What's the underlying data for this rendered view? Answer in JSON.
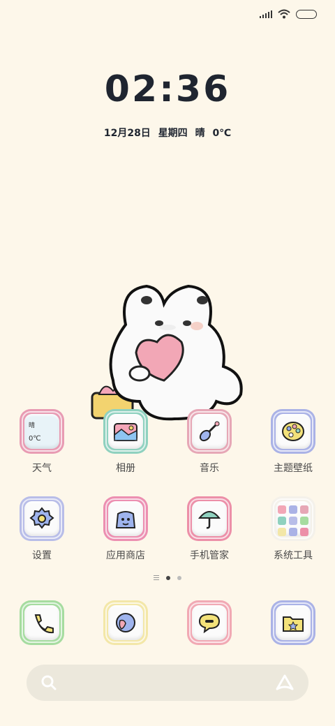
{
  "clock": {
    "time": "02:36"
  },
  "date_line": {
    "date": "12月28日",
    "weekday": "星期四",
    "weather": "晴",
    "temp": "0℃"
  },
  "weather_widget": {
    "condition": "晴",
    "temp": "0℃"
  },
  "apps_row1": [
    {
      "label": "天气",
      "color": "#e89bb3"
    },
    {
      "label": "相册",
      "color": "#8fd1bf"
    },
    {
      "label": "音乐",
      "color": "#e6a7b6"
    },
    {
      "label": "主题壁纸",
      "color": "#aab2e6"
    }
  ],
  "apps_row2": [
    {
      "label": "设置",
      "color": "#b8bde8"
    },
    {
      "label": "应用商店",
      "color": "#ec8fb1"
    },
    {
      "label": "手机管家",
      "color": "#ec8fa8"
    },
    {
      "label": "系统工具",
      "color": "#f4f1ea"
    }
  ],
  "dock": [
    {
      "icon": "phone-icon",
      "color": "#a6dca0"
    },
    {
      "icon": "browser-icon",
      "color": "#f3e7a8"
    },
    {
      "icon": "messages-icon",
      "color": "#f1a9b4"
    },
    {
      "icon": "folder-icon",
      "color": "#aab2e6"
    }
  ],
  "pager": {
    "pages": 2,
    "active": 0
  },
  "colors": {
    "background": "#fdf7ea",
    "search_bar": "#ece8dc"
  }
}
